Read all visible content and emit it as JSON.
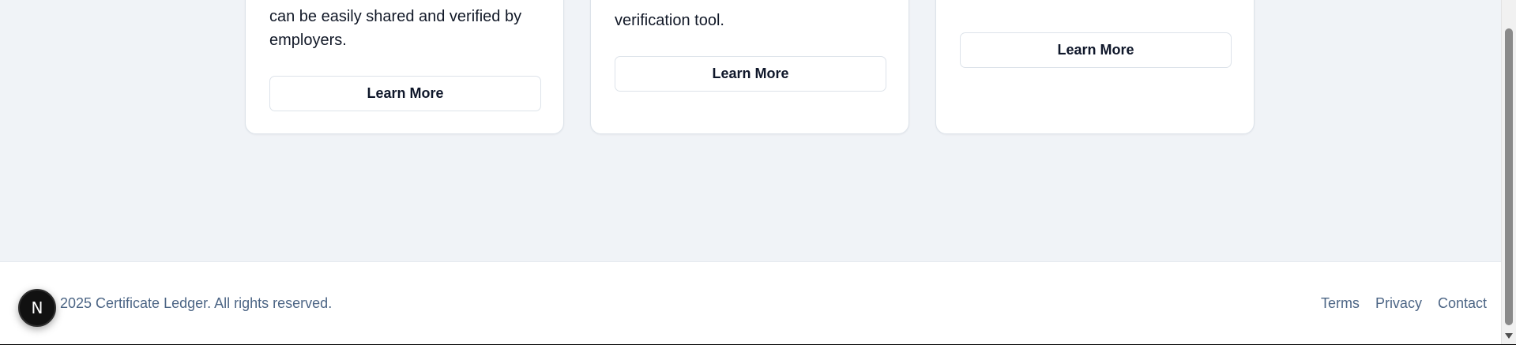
{
  "cards": [
    {
      "lines": [
        "can be easily shared and verified by",
        "employers."
      ],
      "button_label": "Learn More"
    },
    {
      "lines": [
        "verification tool."
      ],
      "button_label": "Learn More"
    },
    {
      "lines": [],
      "button_label": "Learn More"
    }
  ],
  "footer": {
    "copyright": "2025 Certificate Ledger. All rights reserved.",
    "links": [
      "Terms",
      "Privacy",
      "Contact"
    ]
  },
  "dev_badge": {
    "letter": "N"
  }
}
